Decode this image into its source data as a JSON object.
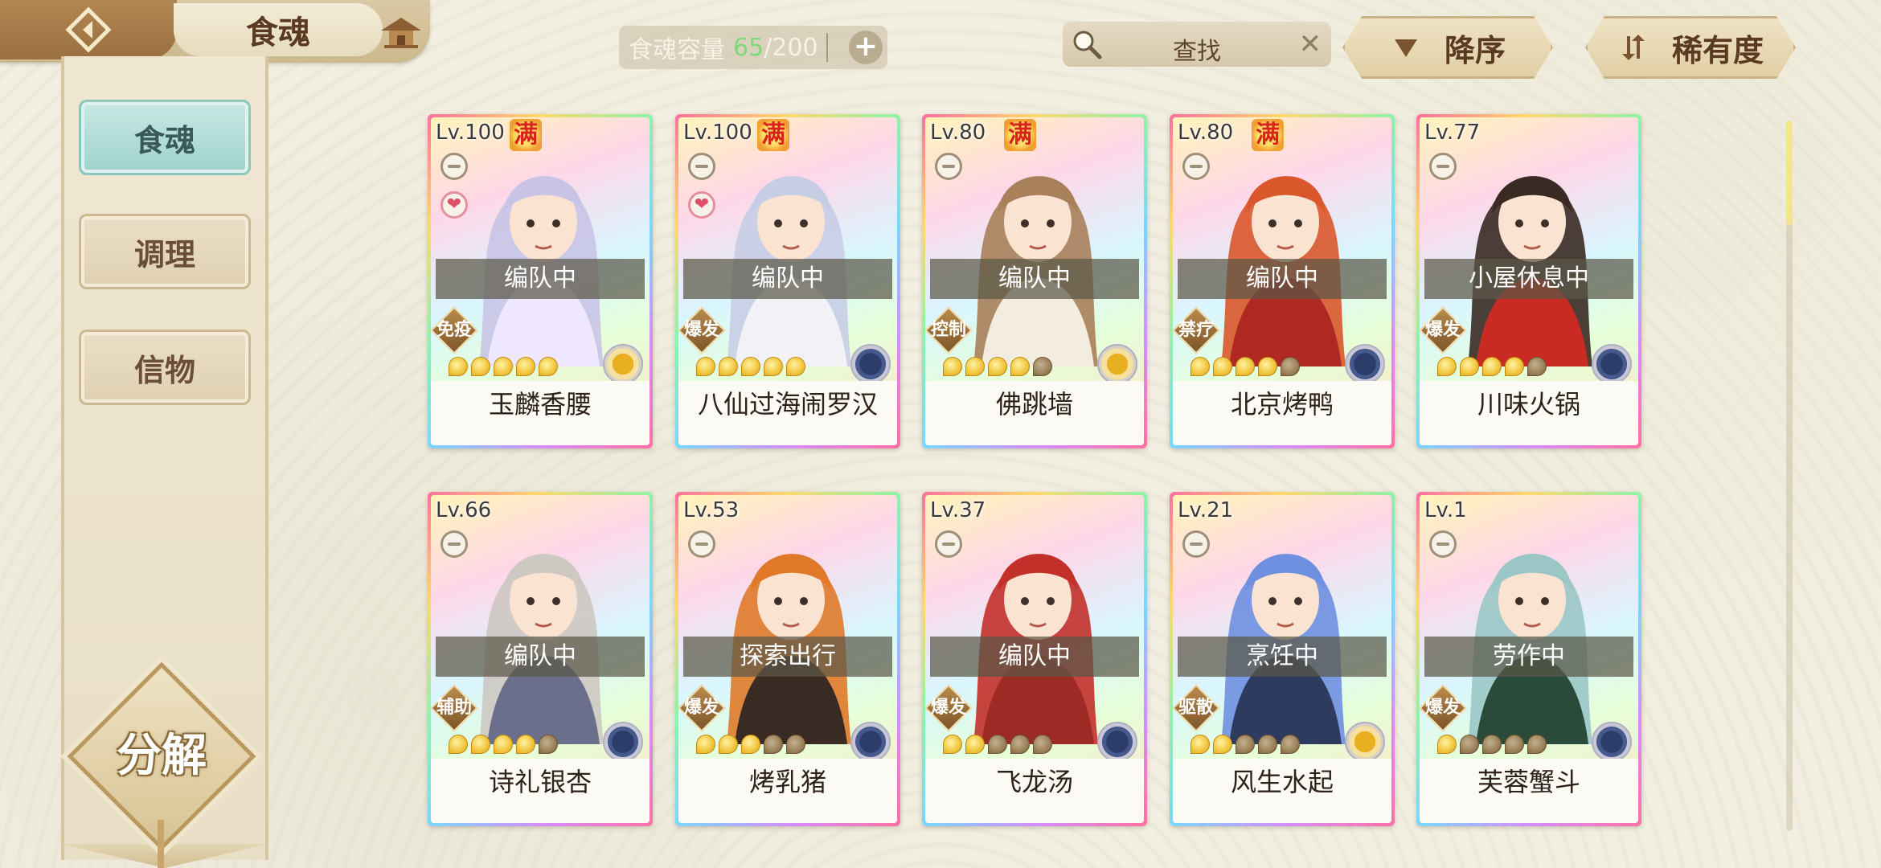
{
  "header": {
    "title": "食魂",
    "capacity_label": "食魂容量",
    "capacity_current": "65",
    "capacity_sep": "/",
    "capacity_max": "200",
    "capacity_add": "+",
    "search_placeholder": "查找",
    "search_clear": "✕",
    "sort_order": "降序",
    "sort_key": "稀有度"
  },
  "sidebar": {
    "tabs": [
      {
        "label": "食魂",
        "active": true
      },
      {
        "label": "调理",
        "active": false
      },
      {
        "label": "信物",
        "active": false
      }
    ],
    "decompose": "分解"
  },
  "cards": [
    {
      "level": "Lv.100",
      "full": "满",
      "heart": true,
      "status": "编队中",
      "role": "免疫",
      "stars": 5,
      "star_total": 5,
      "element": "gold-leaf-icon",
      "name": "玉麟香腰",
      "hair": "#c9c4e6",
      "accent": "#efe6ff"
    },
    {
      "level": "Lv.100",
      "full": "满",
      "heart": true,
      "status": "编队中",
      "role": "爆发",
      "stars": 5,
      "star_total": 5,
      "element": "navy-flower-icon",
      "name": "八仙过海闹罗汉",
      "hair": "#c8cde6",
      "accent": "#f2f2f6"
    },
    {
      "level": "Lv.80",
      "full": "满",
      "heart": false,
      "status": "编队中",
      "role": "控制",
      "stars": 4,
      "star_total": 5,
      "element": "gold-leaf-icon",
      "name": "佛跳墙",
      "hair": "#a8805a",
      "accent": "#f3ede0"
    },
    {
      "level": "Lv.80",
      "full": "满",
      "heart": false,
      "status": "编队中",
      "role": "禁疗",
      "stars": 4,
      "star_total": 5,
      "element": "navy-flower-icon",
      "name": "北京烤鸭",
      "hair": "#d9572a",
      "accent": "#b02822"
    },
    {
      "level": "Lv.77",
      "full": "",
      "heart": false,
      "status": "小屋休息中",
      "role": "爆发",
      "stars": 4,
      "star_total": 5,
      "element": "navy-flower-icon",
      "name": "川味火锅",
      "hair": "#3a2a24",
      "accent": "#c92a22"
    },
    {
      "level": "Lv.66",
      "full": "",
      "heart": false,
      "status": "编队中",
      "role": "辅助",
      "stars": 4,
      "star_total": 5,
      "element": "navy-flower-icon",
      "name": "诗礼银杏",
      "hair": "#cdc8c2",
      "accent": "#6b6f8c"
    },
    {
      "level": "Lv.53",
      "full": "",
      "heart": false,
      "status": "探索出行",
      "role": "爆发",
      "stars": 3,
      "star_total": 5,
      "element": "navy-flower-icon",
      "name": "烤乳猪",
      "hair": "#e07a2a",
      "accent": "#3a2a24"
    },
    {
      "level": "Lv.37",
      "full": "",
      "heart": false,
      "status": "编队中",
      "role": "爆发",
      "stars": 2,
      "star_total": 5,
      "element": "navy-flower-icon",
      "name": "飞龙汤",
      "hair": "#c2302a",
      "accent": "#9e2a26"
    },
    {
      "level": "Lv.21",
      "full": "",
      "heart": false,
      "status": "烹饪中",
      "role": "驱散",
      "stars": 2,
      "star_total": 5,
      "element": "gold-leaf-icon",
      "name": "风生水起",
      "hair": "#6f8fe0",
      "accent": "#2c3b5e"
    },
    {
      "level": "Lv.1",
      "full": "",
      "heart": false,
      "status": "劳作中",
      "role": "爆发",
      "stars": 1,
      "star_total": 5,
      "element": "navy-flower-icon",
      "name": "芙蓉蟹斗",
      "hair": "#9ac6c6",
      "accent": "#2a4a3a"
    }
  ],
  "colors": {
    "accent_teal": "#9fd3cc",
    "capacity_green": "#7ed97a",
    "frame_brown": "#9b7040"
  }
}
